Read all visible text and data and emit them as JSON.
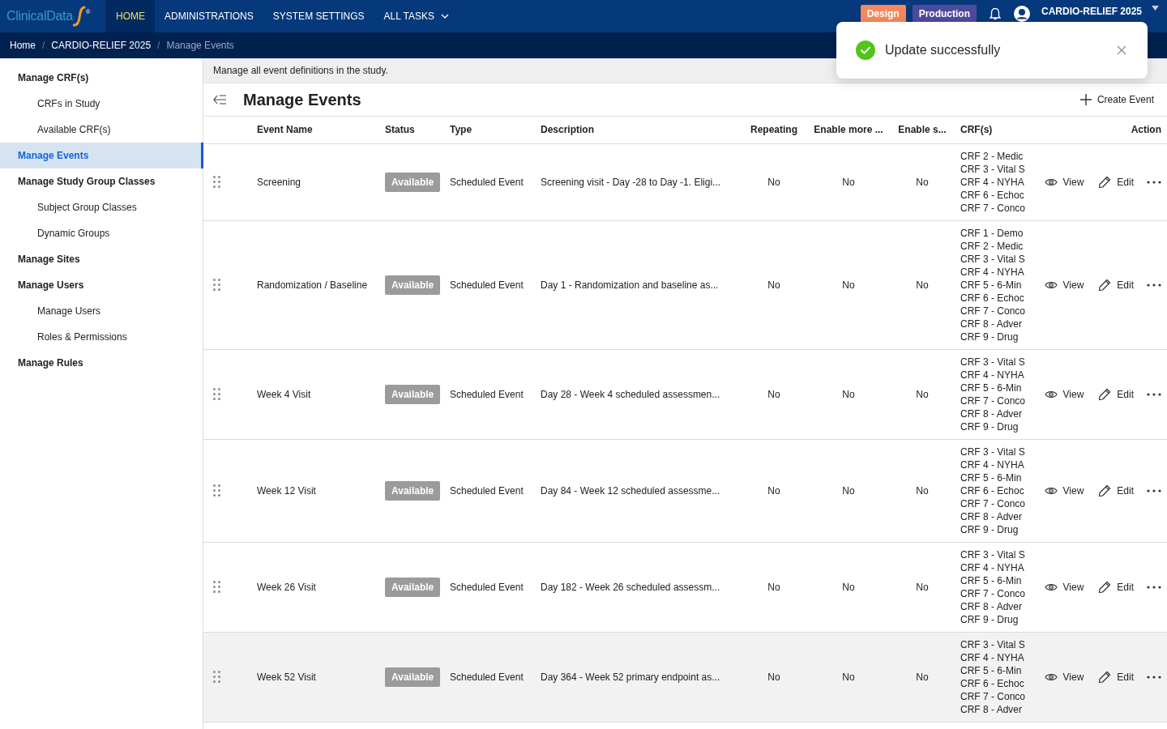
{
  "navbar": {
    "logo": {
      "text": "ClinicalData",
      "mark": "®"
    },
    "items": [
      {
        "label": "HOME",
        "selected": true,
        "dropdown": false
      },
      {
        "label": "ADMINISTRATIONS",
        "selected": false,
        "dropdown": false
      },
      {
        "label": "SYSTEM SETTINGS",
        "selected": false,
        "dropdown": false
      },
      {
        "label": "ALL TASKS",
        "selected": false,
        "dropdown": true
      }
    ],
    "environments": [
      {
        "label": "Design",
        "color": "#f7875c"
      },
      {
        "label": "Production",
        "color": "#4d4a9e"
      }
    ],
    "study": {
      "name": "CARDIO-RELIEF 2025"
    }
  },
  "breadcrumb": [
    {
      "label": "Home",
      "current": false
    },
    {
      "separator": "/",
      "label": "CARDIO-RELIEF 2025",
      "current": false
    },
    {
      "separator": "/",
      "label": "Manage Events",
      "current": true
    }
  ],
  "sidebar": {
    "items": [
      {
        "label": "Manage CRF(s)",
        "selected": false,
        "children": [
          {
            "label": "CRFs in Study",
            "selected": false
          },
          {
            "label": "Available CRF(s)",
            "selected": false
          }
        ]
      },
      {
        "label": "Manage Events",
        "selected": true
      },
      {
        "label": "Manage Study Group Classes",
        "selected": false,
        "children": [
          {
            "label": "Subject Group Classes",
            "selected": false
          },
          {
            "label": "Dynamic Groups",
            "selected": false
          }
        ]
      },
      {
        "label": "Manage Sites",
        "selected": false
      },
      {
        "label": "Manage Users",
        "selected": false,
        "children": [
          {
            "label": "Manage Users",
            "selected": false
          },
          {
            "label": "Roles & Permissions",
            "selected": false
          }
        ]
      },
      {
        "label": "Manage Rules",
        "selected": false
      }
    ]
  },
  "page": {
    "description": "Manage all event definitions in the study.",
    "title": "Manage Events",
    "create_button": "Create Event"
  },
  "table": {
    "columns": [
      {
        "label": "Event Name",
        "kind": "text"
      },
      {
        "label": "Status",
        "kind": "badge"
      },
      {
        "label": "Type",
        "kind": "text"
      },
      {
        "label": "Description",
        "kind": "text"
      },
      {
        "label": "Repeating",
        "kind": "flag"
      },
      {
        "label": "Enable more ...",
        "kind": "flag"
      },
      {
        "label": "Enable s...",
        "kind": "flag"
      },
      {
        "label": "CRF(s)",
        "kind": "list"
      },
      {
        "label": "Action",
        "kind": "actions"
      }
    ],
    "rows": [
      {
        "event_name": "Screening",
        "status": "Available",
        "type": "Scheduled Event",
        "description": "Screening visit - Day -28 to Day -1. Eligi...",
        "repeating": "No",
        "column_6": "No",
        "column_7": "No",
        "crfs": [
          "CRF 2 - Medic",
          "CRF 3 - Vital S",
          "CRF 4 - NYHA",
          "CRF 6 - Echoc",
          "CRF 7 - Conco"
        ],
        "actions": [
          {
            "kind": "view",
            "label": "View"
          },
          {
            "kind": "edit",
            "label": "Edit"
          },
          {
            "kind": "more"
          }
        ],
        "highlighted": false
      },
      {
        "event_name": "Randomization / Baseline",
        "status": "Available",
        "type": "Scheduled Event",
        "description": "Day 1 - Randomization and baseline as...",
        "repeating": "No",
        "column_6": "No",
        "column_7": "No",
        "crfs": [
          "CRF 1 - Demo",
          "CRF 2 - Medic",
          "CRF 3 - Vital S",
          "CRF 4 - NYHA",
          "CRF 5 - 6-Min",
          "CRF 6 - Echoc",
          "CRF 7 - Conco",
          "CRF 8 - Adver",
          "CRF 9 - Drug"
        ],
        "actions": [
          {
            "kind": "view",
            "label": "View"
          },
          {
            "kind": "edit",
            "label": "Edit"
          },
          {
            "kind": "more"
          }
        ],
        "highlighted": false
      },
      {
        "event_name": "Week 4 Visit",
        "status": "Available",
        "type": "Scheduled Event",
        "description": "Day 28 - Week 4 scheduled assessmen...",
        "repeating": "No",
        "column_6": "No",
        "column_7": "No",
        "crfs": [
          "CRF 3 - Vital S",
          "CRF 4 - NYHA",
          "CRF 5 - 6-Min",
          "CRF 7 - Conco",
          "CRF 8 - Adver",
          "CRF 9 - Drug"
        ],
        "actions": [
          {
            "kind": "view",
            "label": "View"
          },
          {
            "kind": "edit",
            "label": "Edit"
          },
          {
            "kind": "more"
          }
        ],
        "highlighted": false
      },
      {
        "event_name": "Week 12 Visit",
        "status": "Available",
        "type": "Scheduled Event",
        "description": "Day 84 - Week 12 scheduled assessme...",
        "repeating": "No",
        "column_6": "No",
        "column_7": "No",
        "crfs": [
          "CRF 3 - Vital S",
          "CRF 4 - NYHA",
          "CRF 5 - 6-Min",
          "CRF 6 - Echoc",
          "CRF 7 - Conco",
          "CRF 8 - Adver",
          "CRF 9 - Drug"
        ],
        "actions": [
          {
            "kind": "view",
            "label": "View"
          },
          {
            "kind": "edit",
            "label": "Edit"
          },
          {
            "kind": "more"
          }
        ],
        "highlighted": false
      },
      {
        "event_name": "Week 26 Visit",
        "status": "Available",
        "type": "Scheduled Event",
        "description": "Day 182 - Week 26 scheduled assessm...",
        "repeating": "No",
        "column_6": "No",
        "column_7": "No",
        "crfs": [
          "CRF 3 - Vital S",
          "CRF 4 - NYHA",
          "CRF 5 - 6-Min",
          "CRF 7 - Conco",
          "CRF 8 - Adver",
          "CRF 9 - Drug"
        ],
        "actions": [
          {
            "kind": "view",
            "label": "View"
          },
          {
            "kind": "edit",
            "label": "Edit"
          },
          {
            "kind": "more"
          }
        ],
        "highlighted": false
      },
      {
        "event_name": "Week 52 Visit",
        "status": "Available",
        "type": "Scheduled Event",
        "description": "Day 364 - Week 52 primary endpoint as...",
        "repeating": "No",
        "column_6": "No",
        "column_7": "No",
        "crfs": [
          "CRF 3 - Vital S",
          "CRF 4 - NYHA",
          "CRF 5 - 6-Min",
          "CRF 6 - Echoc",
          "CRF 7 - Conco",
          "CRF 8 - Adver"
        ],
        "actions": [
          {
            "kind": "view",
            "label": "View"
          },
          {
            "kind": "edit",
            "label": "Edit"
          },
          {
            "kind": "more"
          }
        ],
        "highlighted": true
      }
    ]
  },
  "toast": {
    "kind": "success",
    "message": "Update successfully"
  }
}
